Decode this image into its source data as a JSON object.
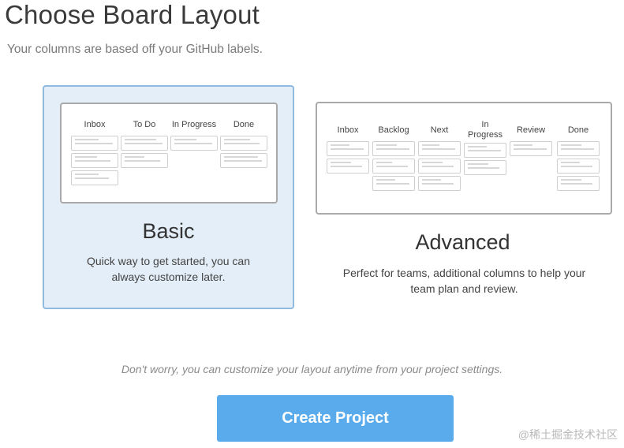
{
  "page": {
    "title": "Choose Board Layout",
    "subtitle": "Your columns are based off your GitHub labels."
  },
  "layouts": {
    "basic": {
      "title": "Basic",
      "description": "Quick way to get started, you can always customize later.",
      "selected": true,
      "columns": [
        {
          "label": "Inbox",
          "tiles": 3
        },
        {
          "label": "To Do",
          "tiles": 2
        },
        {
          "label": "In Progress",
          "tiles": 1
        },
        {
          "label": "Done",
          "tiles": 2
        }
      ]
    },
    "advanced": {
      "title": "Advanced",
      "description": "Perfect for teams, additional columns to help your team plan and review.",
      "selected": false,
      "columns": [
        {
          "label": "Inbox",
          "tiles": 2
        },
        {
          "label": "Backlog",
          "tiles": 3
        },
        {
          "label": "Next",
          "tiles": 3
        },
        {
          "label": "In Progress",
          "tiles": 2
        },
        {
          "label": "Review",
          "tiles": 1
        },
        {
          "label": "Done",
          "tiles": 3
        }
      ]
    }
  },
  "note": "Don't worry, you can customize your layout anytime from your project settings.",
  "create_button": {
    "label": "Create Project"
  },
  "watermark": "@稀土掘金技术社区",
  "colors": {
    "accent": "#5aabec",
    "selected_bg": "#e3eef8",
    "selected_border": "#8fbbe0"
  }
}
